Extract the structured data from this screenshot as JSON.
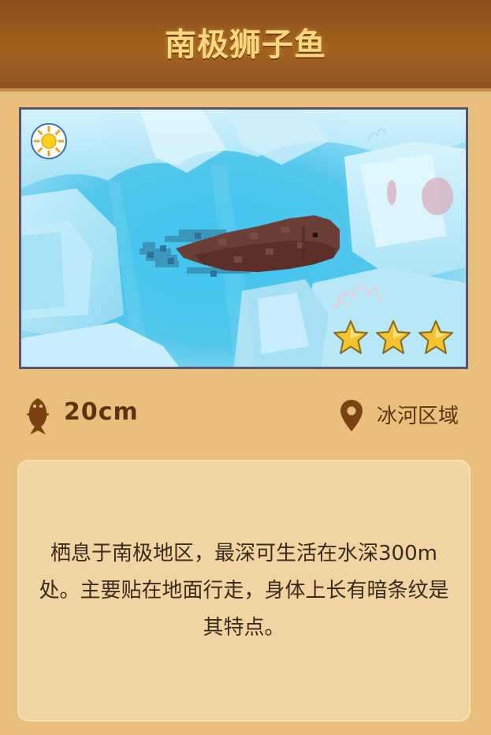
{
  "card": {
    "title": "南极狮子鱼",
    "weather_icon": "sun-icon",
    "rarity_stars": 3,
    "max_stars": 3,
    "size": "20cm",
    "location": "冰河区域",
    "description": "栖息于南极地区，最深可生活在水深300m处。主要贴在地面行走，身体上长有暗条纹是其特点。"
  },
  "colors": {
    "header_bg": "#8a4d1c",
    "title_text": "#ffd77c",
    "card_bg": "#e8c07c",
    "desc_bg": "#f1d4a2",
    "star": "#f4c331"
  }
}
